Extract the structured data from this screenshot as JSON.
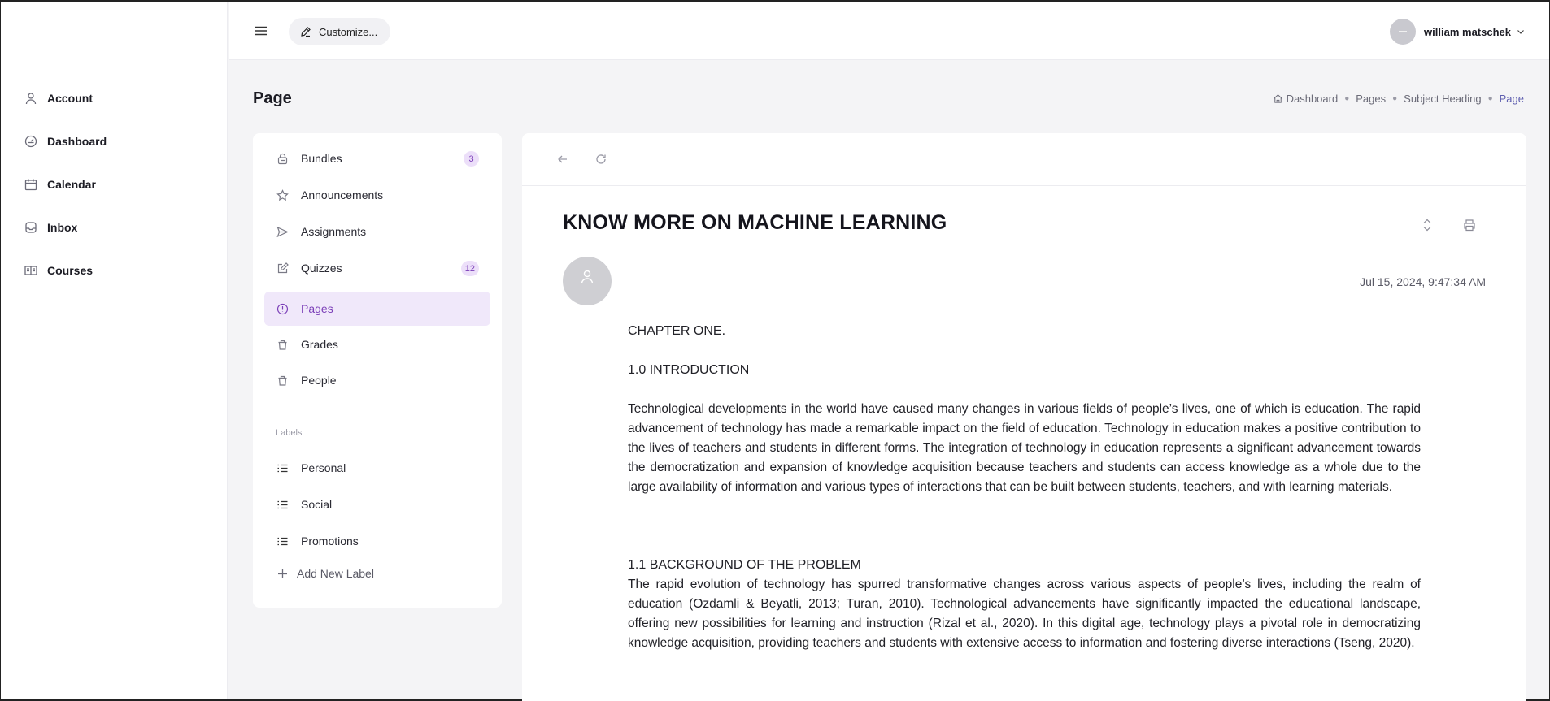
{
  "app": {
    "nav": [
      {
        "name": "account",
        "label": "Account",
        "icon": "user-icon"
      },
      {
        "name": "dashboard",
        "label": "Dashboard",
        "icon": "gauge-icon"
      },
      {
        "name": "calendar",
        "label": "Calendar",
        "icon": "calendar-icon"
      },
      {
        "name": "inbox",
        "label": "Inbox",
        "icon": "inbox-icon"
      },
      {
        "name": "courses",
        "label": "Courses",
        "icon": "book-open-icon"
      }
    ]
  },
  "topbar": {
    "customize_label": "Customize...",
    "user_name": "william matschek"
  },
  "page": {
    "title": "Page",
    "breadcrumb": [
      "Dashboard",
      "Pages",
      "Subject Heading",
      "Page"
    ]
  },
  "subnav": {
    "items": [
      {
        "label": "Bundles",
        "badge": "3",
        "icon": "lock-icon"
      },
      {
        "label": "Announcements",
        "badge": "",
        "icon": "star-icon"
      },
      {
        "label": "Assignments",
        "badge": "",
        "icon": "send-icon"
      },
      {
        "label": "Quizzes",
        "badge": "12",
        "icon": "edit-icon"
      },
      {
        "label": "Pages",
        "badge": "",
        "icon": "info-circle-icon",
        "active": true
      },
      {
        "label": "Grades",
        "badge": "",
        "icon": "trash-icon"
      },
      {
        "label": "People",
        "badge": "",
        "icon": "trash-icon"
      }
    ],
    "labels_heading": "Labels",
    "labels": [
      {
        "label": "Personal",
        "icon": "list-icon"
      },
      {
        "label": "Social",
        "icon": "list-icon"
      },
      {
        "label": "Promotions",
        "icon": "list-icon"
      }
    ],
    "add_label": "Add New Label"
  },
  "article": {
    "title": "KNOW MORE ON MACHINE LEARNING",
    "date": "Jul 15, 2024, 9:47:34 AM",
    "chapter": "CHAPTER ONE.",
    "intro_heading": "1.0 INTRODUCTION",
    "intro_text": "Technological developments in the world have caused many changes in various fields of people’s lives, one of which is education. The rapid advancement of technology has made a remarkable impact on the field of education. Technology in education makes a positive contribution to the lives of teachers and students in different forms. The integration of technology in education represents a significant advancement towards the democratization and expansion of knowledge acquisition because teachers and students can access knowledge as a whole due to the large availability of information and various types of interactions that can be built between students, teachers, and with learning materials.",
    "background_heading": "1.1 BACKGROUND OF THE PROBLEM",
    "background_text": "The rapid evolution of technology has spurred transformative changes across various aspects of people’s lives, including the realm of education (Ozdamli & Beyatli, 2013; Turan, 2010). Technological advancements have significantly impacted the educational landscape, offering new possibilities for learning and instruction (Rizal et al., 2020). In this digital age, technology plays a pivotal role in democratizing knowledge acquisition, providing teachers and students with extensive access to information and fostering diverse interactions (Tseng, 2020)."
  }
}
